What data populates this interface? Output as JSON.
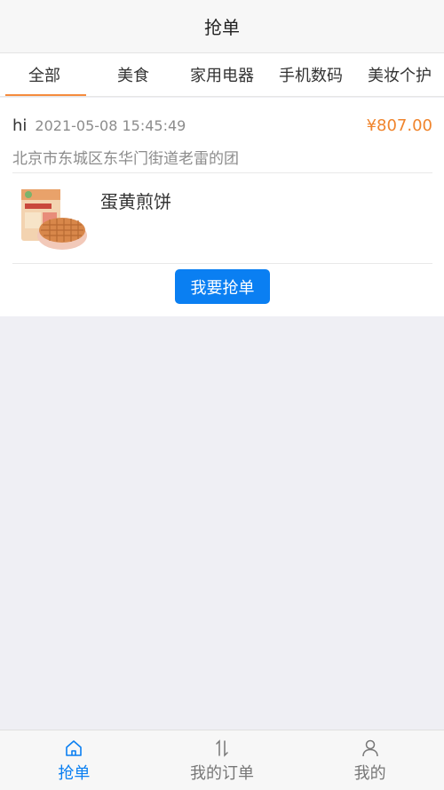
{
  "header": {
    "title": "抢单"
  },
  "tabs": [
    {
      "label": "全部",
      "active": true
    },
    {
      "label": "美食"
    },
    {
      "label": "家用电器"
    },
    {
      "label": "手机数码"
    },
    {
      "label": "美妆个护"
    }
  ],
  "order": {
    "user": "hi",
    "time": "2021-05-08 15:45:49",
    "price": "¥807.00",
    "address": "北京市东城区东华门街道老雷的团",
    "product_name": "蛋黄煎饼",
    "grab_label": "我要抢单"
  },
  "tabbar": [
    {
      "label": "抢单",
      "icon": "home-icon",
      "active": true
    },
    {
      "label": "我的订单",
      "icon": "sort-arrows-icon"
    },
    {
      "label": "我的",
      "icon": "user-icon"
    }
  ],
  "colors": {
    "accent": "#0a7ff2",
    "price": "#f0842c",
    "tab_indicator": "#f58b3d"
  }
}
